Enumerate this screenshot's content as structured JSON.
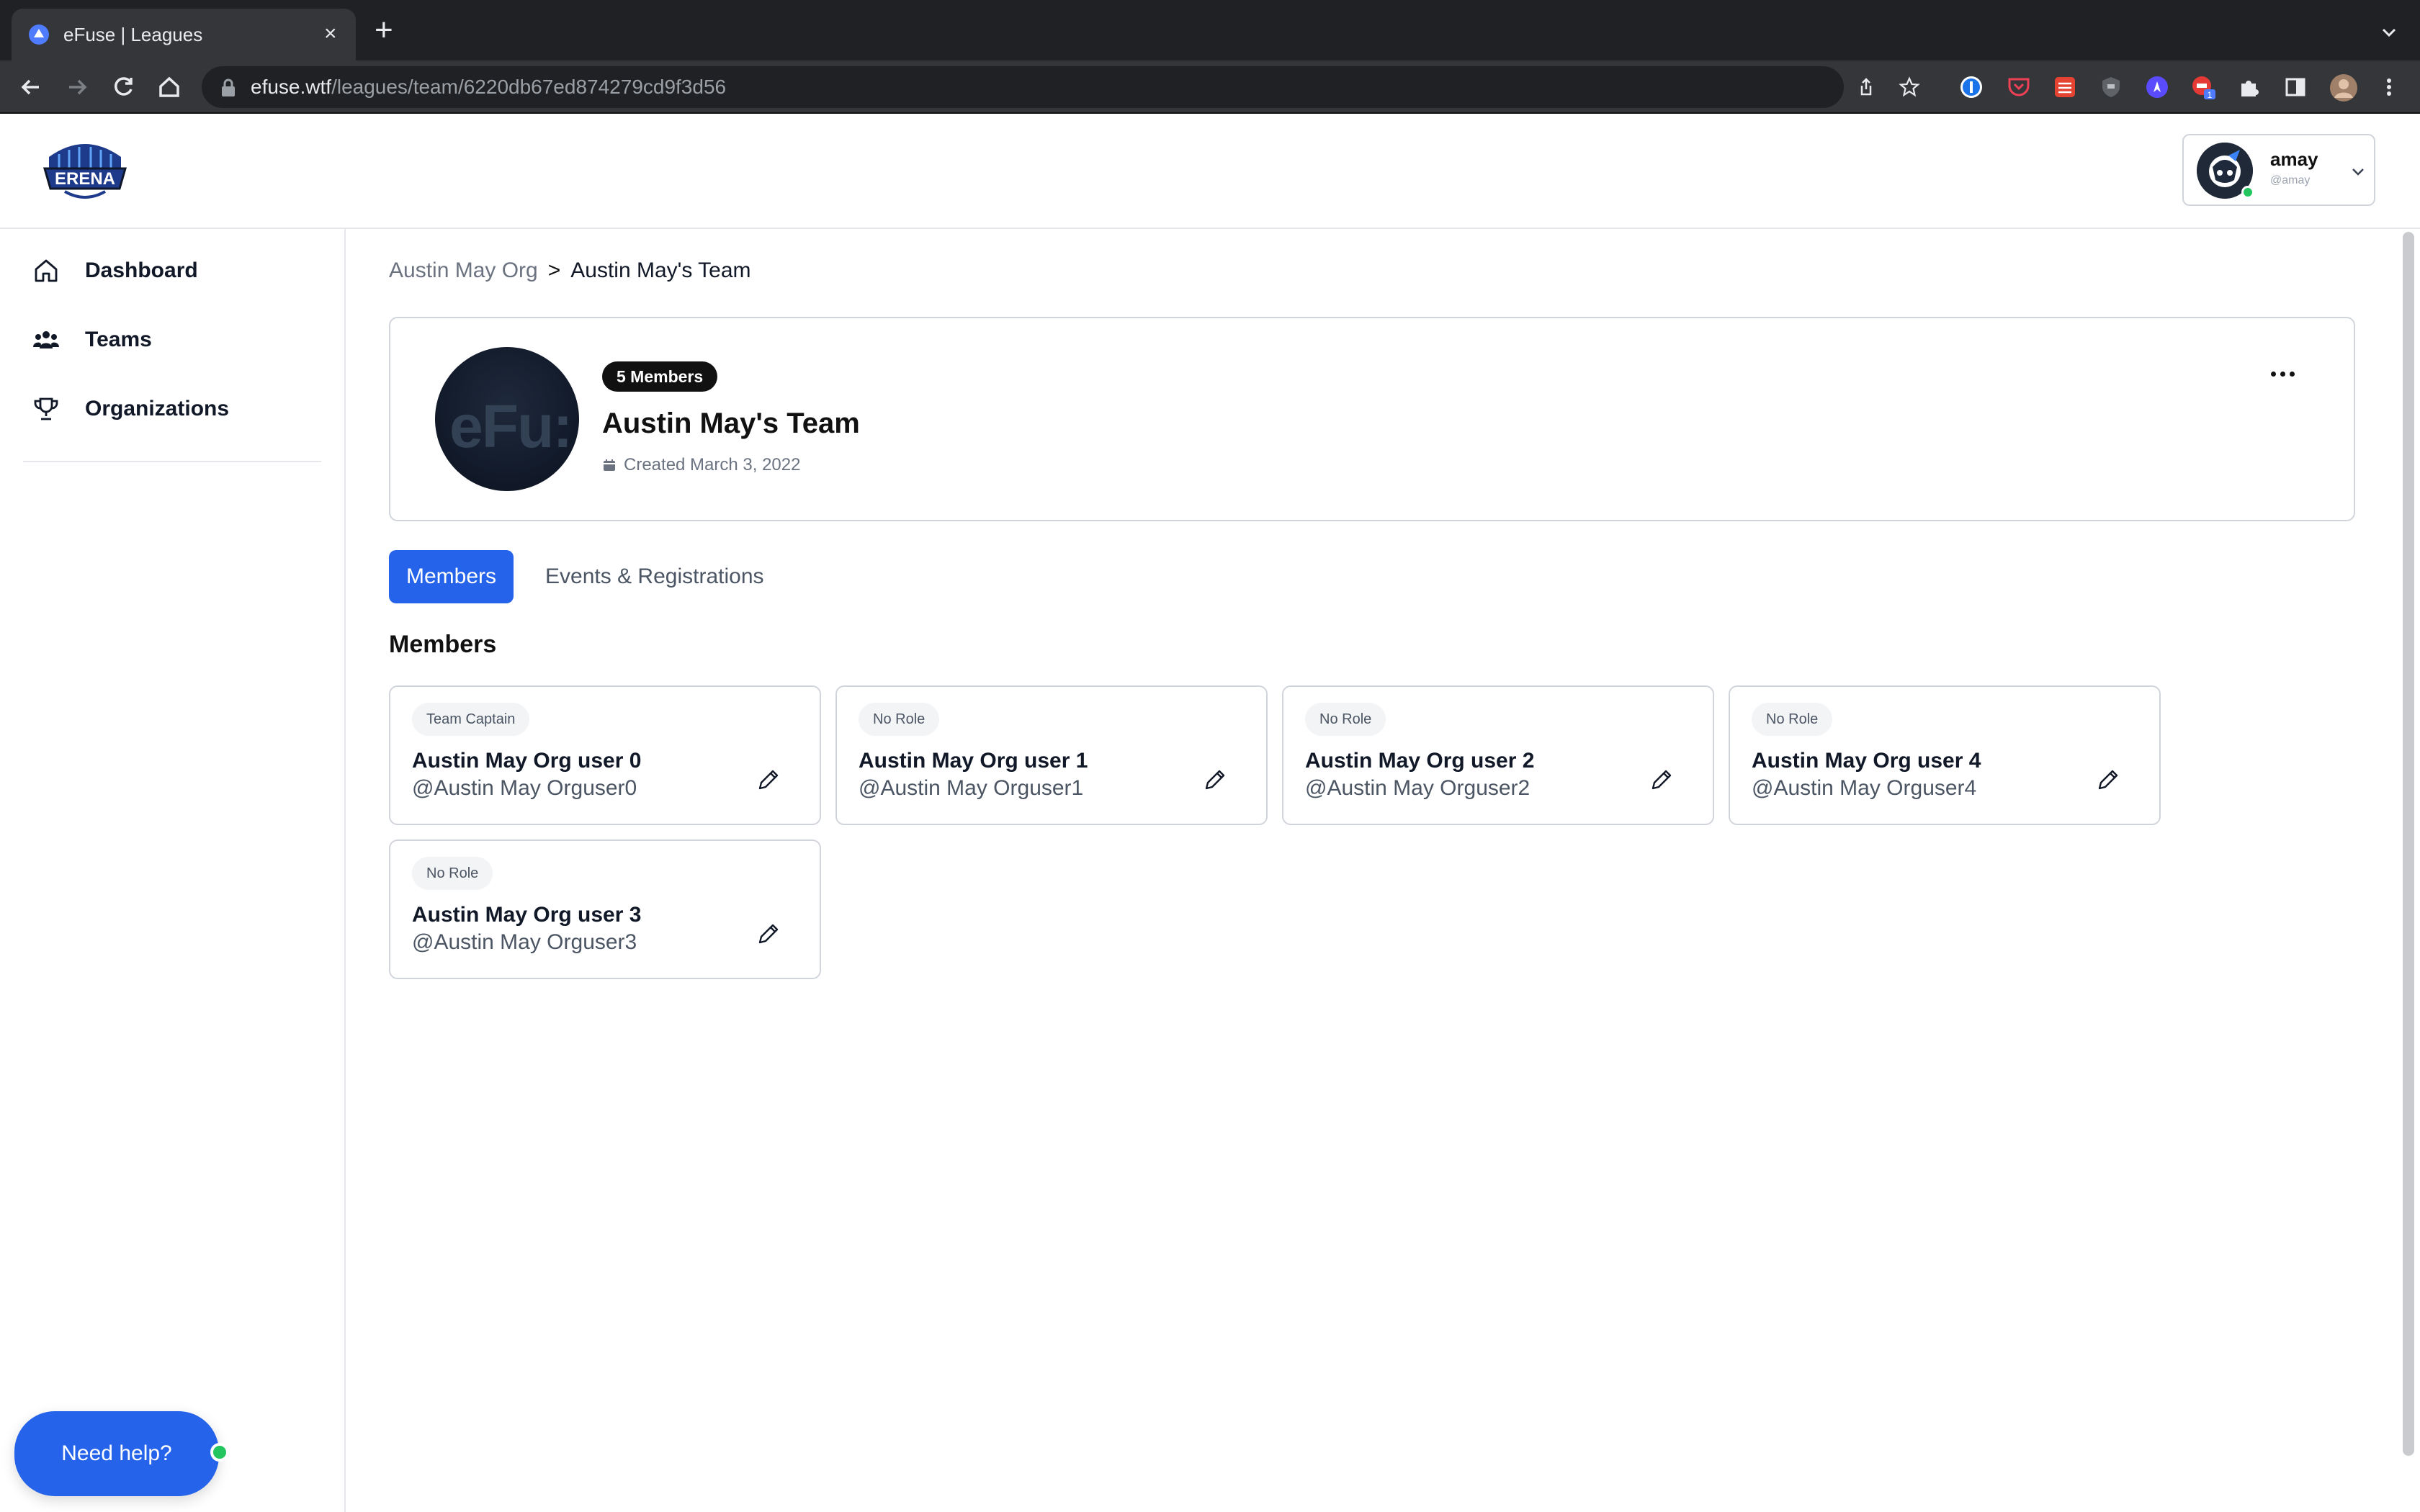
{
  "browser": {
    "tab_title": "eFuse | Leagues",
    "tab_close": "×",
    "new_tab": "+",
    "url_host": "efuse.wtf",
    "url_path": "/leagues/team/6220db67ed874279cd9f3d56",
    "extension_badge": "1"
  },
  "header": {
    "logo_text": "ERENA",
    "user_name": "amay",
    "user_handle": "@amay"
  },
  "sidebar": {
    "items": [
      {
        "label": "Dashboard",
        "icon": "home-icon"
      },
      {
        "label": "Teams",
        "icon": "users-icon"
      },
      {
        "label": "Organizations",
        "icon": "trophy-icon"
      }
    ],
    "help_label": "Need help?"
  },
  "breadcrumb": {
    "parent": "Austin May Org",
    "separator": ">",
    "current": "Austin May's Team"
  },
  "team": {
    "members_badge": "5 Members",
    "name": "Austin May's Team",
    "created": "Created March 3, 2022",
    "avatar_text_a": "eF",
    "avatar_text_b": "u:"
  },
  "tabs": [
    {
      "label": "Members",
      "active": true
    },
    {
      "label": "Events & Registrations",
      "active": false
    }
  ],
  "members_section_title": "Members",
  "members": [
    {
      "role": "Team Captain",
      "name": "Austin May Org user 0",
      "handle": "@Austin May Orguser0"
    },
    {
      "role": "No Role",
      "name": "Austin May Org user 1",
      "handle": "@Austin May Orguser1"
    },
    {
      "role": "No Role",
      "name": "Austin May Org user 2",
      "handle": "@Austin May Orguser2"
    },
    {
      "role": "No Role",
      "name": "Austin May Org user 4",
      "handle": "@Austin May Orguser4"
    },
    {
      "role": "No Role",
      "name": "Austin May Org user 3",
      "handle": "@Austin May Orguser3"
    }
  ],
  "colors": {
    "accent": "#2563eb",
    "online": "#22c55e",
    "chrome_dark": "#202124"
  }
}
